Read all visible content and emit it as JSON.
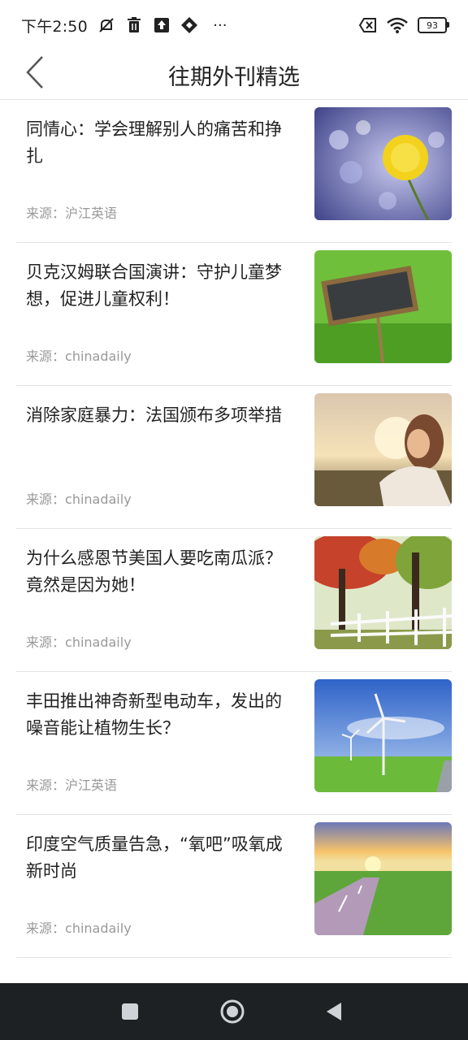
{
  "status_bar": {
    "time": "下午2:50",
    "more": "···",
    "battery": "93",
    "icons": [
      "mute-icon",
      "trash-icon",
      "upload-icon",
      "app-icon",
      "sim-off-icon",
      "wifi-icon",
      "battery-icon"
    ]
  },
  "header": {
    "title": "往期外刊精选",
    "back_icon": "chevron-left-icon"
  },
  "source_label": "来源：",
  "articles": [
    {
      "title": "同情心：学会理解别人的痛苦和挣扎",
      "source": "沪江英语",
      "thumb": "yellow-dandelion-flower"
    },
    {
      "title": "贝克汉姆联合国演讲：守护儿童梦想，促进儿童权利！",
      "source": "chinadaily",
      "thumb": "faq-sign-on-grass"
    },
    {
      "title": "消除家庭暴力：法国颁布多项举措",
      "source": "chinadaily",
      "thumb": "woman-in-sunlight"
    },
    {
      "title": "为什么感恩节美国人要吃南瓜派？竟然是因为她！",
      "source": "chinadaily",
      "thumb": "autumn-forest-fence"
    },
    {
      "title": "丰田推出神奇新型电动车，发出的噪音能让植物生长？",
      "source": "沪江英语",
      "thumb": "wind-turbines-field"
    },
    {
      "title": "印度空气质量告急，“氧吧”吸氧成新时尚",
      "source": "chinadaily",
      "thumb": "sunset-road"
    }
  ],
  "nav_bar": {
    "icons": [
      "recent-apps-icon",
      "home-icon",
      "back-icon"
    ]
  }
}
